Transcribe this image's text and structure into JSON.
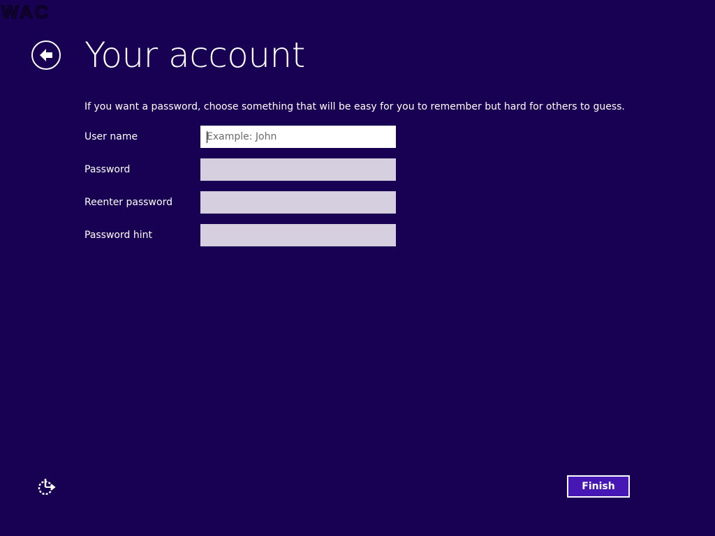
{
  "watermark": "WAC",
  "header": {
    "back_icon": "back-arrow-circle-icon",
    "title": "Your account"
  },
  "intro_text": "If you want a password, choose something that will be easy for you to remember but hard for others to guess.",
  "form": {
    "fields": [
      {
        "label": "User name",
        "value": "",
        "placeholder": "Example: John",
        "focused": true
      },
      {
        "label": "Password",
        "value": "",
        "placeholder": ""
      },
      {
        "label": "Reenter password",
        "value": "",
        "placeholder": ""
      },
      {
        "label": "Password hint",
        "value": "",
        "placeholder": ""
      }
    ]
  },
  "footer": {
    "ease_of_access_icon": "ease-of-access-icon",
    "finish_label": "Finish"
  },
  "colors": {
    "background": "#180052",
    "button_fill": "#4617b4",
    "input_inactive": "#d5cfe0",
    "input_active": "#ffffff"
  }
}
